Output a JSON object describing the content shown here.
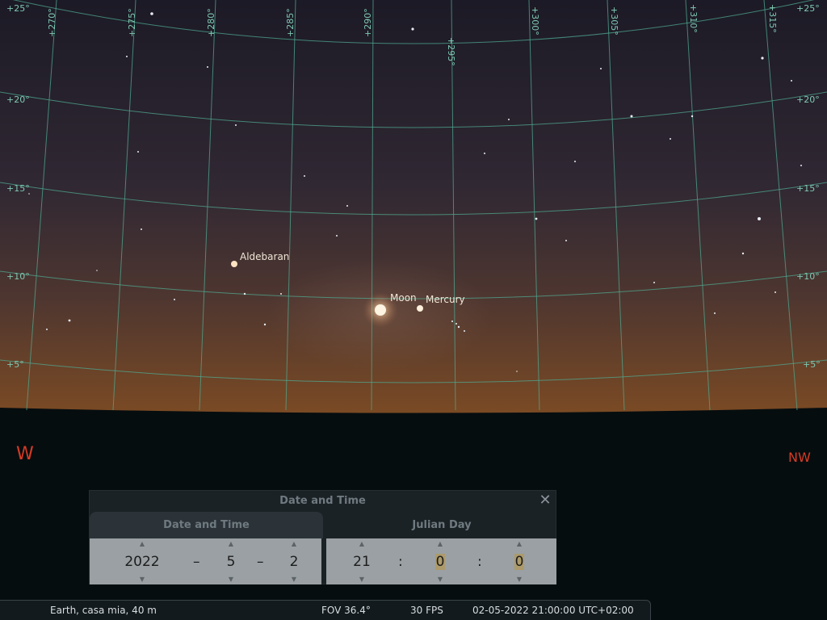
{
  "sky": {
    "colors": {
      "sky_top": "#1c1a26",
      "sky_mid": "#342a32",
      "sky_horizon": "#7a4a24",
      "ground": "#060d0f",
      "grid": "#4fa88f",
      "label": "#7fc8b2",
      "cardinal": "#d63b24"
    },
    "altitude_labels": [
      "+25°",
      "+20°",
      "+15°",
      "+10°",
      "+5°"
    ],
    "azimuth_labels": [
      "+270°",
      "+275°",
      "+280°",
      "+285°",
      "+290°",
      "+295°",
      "+300°",
      "+305°",
      "+310°",
      "+315°"
    ],
    "objects": {
      "aldebaran": "Aldebaran",
      "moon": "Moon",
      "mercury": "Mercury"
    },
    "cardinals": {
      "west": "W",
      "northwest": "NW"
    }
  },
  "dialog": {
    "title": "Date and Time",
    "close_icon": "close-icon",
    "tabs": {
      "date": "Date and Time",
      "julian": "Julian Day"
    },
    "date": {
      "year": "2022",
      "sep1": "–",
      "month": "5",
      "sep2": "–",
      "day": "2"
    },
    "time": {
      "hour": "21",
      "sep1": ":",
      "minute": "0",
      "sep2": ":",
      "second": "0"
    }
  },
  "status": {
    "location": "Earth, casa mia, 40 m",
    "fov": "FOV 36.4°",
    "fps": "30 FPS",
    "datetime": "02-05-2022 21:00:00 UTC+02:00"
  }
}
